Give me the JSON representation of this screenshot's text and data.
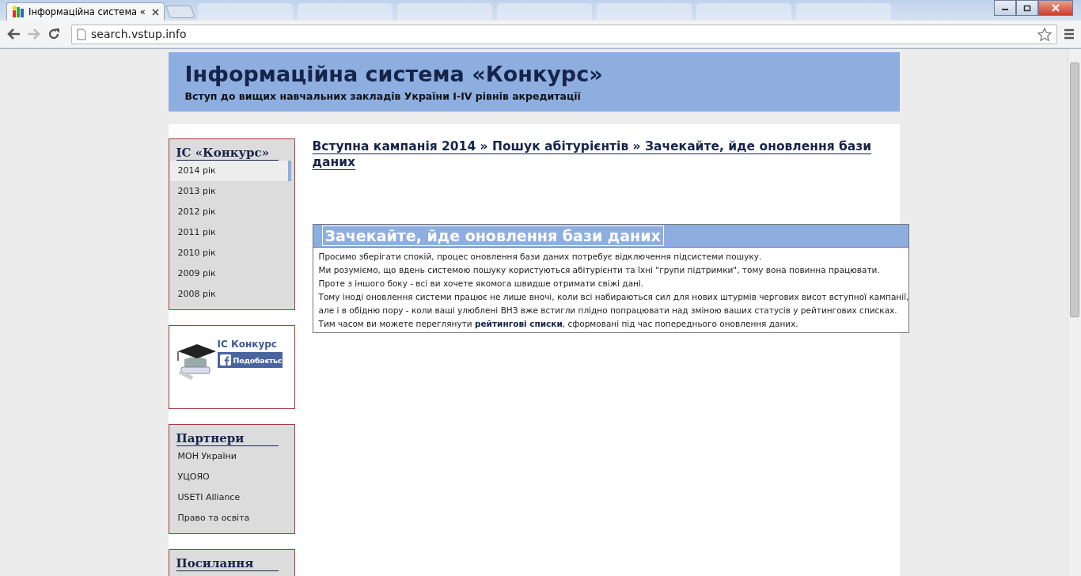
{
  "browser": {
    "active_tab": {
      "title": "Інформаційна система «"
    },
    "url": "search.vstup.info"
  },
  "header": {
    "title": "Інформаційна система «Конкурс»",
    "subtitle": "Вступ до вищих навчальних закладів України I-IV рівнів акредитації"
  },
  "sidebar": {
    "years_box": {
      "title": "ІС «Конкурс»",
      "items": [
        {
          "label": "2014 рік",
          "selected": true
        },
        {
          "label": "2013 рік",
          "selected": false
        },
        {
          "label": "2012 рік",
          "selected": false
        },
        {
          "label": "2011 рік",
          "selected": false
        },
        {
          "label": "2010 рік",
          "selected": false
        },
        {
          "label": "2009 рік",
          "selected": false
        },
        {
          "label": "2008 рік",
          "selected": false
        }
      ]
    },
    "facebook_box": {
      "page_name": "ІС Конкурс",
      "like_button": "Подобаєтьс"
    },
    "partners_box": {
      "title": "Партнери",
      "items": [
        "МОН України",
        "УЦОЯО",
        "USETI Alliance",
        "Право та освіта"
      ]
    },
    "links_box": {
      "title": "Посилання"
    }
  },
  "main": {
    "breadcrumb": "Вступна кампанія 2014 » Пошук абітурієнтів » Зачекайте, йде оновлення бази даних",
    "notice": {
      "title": "Зачекайте, йде оновлення бази даних",
      "lines": [
        "Просимо зберігати спокій, процес оновлення бази даних потребує відключення підсистеми пошуку.",
        "Ми розуміємо, що вдень системою пошуку користуються абітурієнти та їхні \"групи підтримки\", тому вона повинна працювати.",
        "Проте з іншого боку - всі ви хочете якомога швидше отримати свіжі дані.",
        "Тому іноді оновлення системи працює не лише вночі, коли всі набираються сил для нових штурмів чергових висот вступної кампанії,",
        "але і в обідню пору - коли ваші улюблені ВНЗ вже встигли плідно попрацювати над зміною ваших статусів у рейтингових списках."
      ],
      "last_line": {
        "before": "Тим часом ви можете переглянути ",
        "link": "рейтингові списки",
        "after": ", сформовані під час попереднього оновлення даних."
      }
    }
  }
}
